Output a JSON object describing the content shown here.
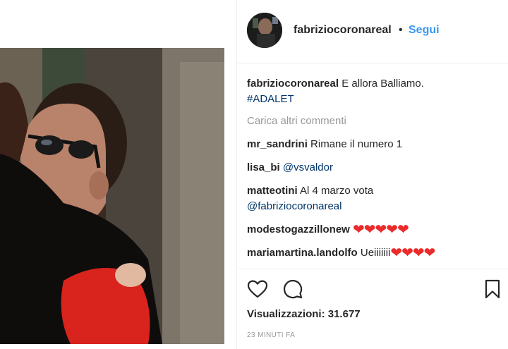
{
  "post": {
    "photo_alt": "",
    "header": {
      "username": "fabriziocoronareal",
      "separator": "•",
      "follow_label": "Segui"
    },
    "caption": {
      "username": "fabriziocoronareal",
      "text": "E allora Balliamo.",
      "hashtag": "#ADALET"
    },
    "load_more_label": "Carica altri commenti",
    "comments": [
      {
        "username": "mr_sandrini",
        "text": "Rimane il numero 1",
        "link": "",
        "hearts": ""
      },
      {
        "username": "lisa_bi",
        "text": "",
        "link": "@vsvaldor",
        "hearts": ""
      },
      {
        "username": "matteotini",
        "text": "Al 4 marzo vota",
        "link": "@fabriziocoronareal",
        "hearts": ""
      },
      {
        "username": "modestogazzillonew",
        "text": "",
        "link": "",
        "hearts": "❤❤❤❤❤"
      },
      {
        "username": "mariamartina.landolfo",
        "text": "Ueiiiiiii",
        "link": "",
        "hearts": "❤❤❤❤"
      }
    ],
    "views": "Visualizzazioni: 31.677",
    "timestamp": "23 MINUTI FA"
  },
  "icons": {
    "like": "heart-outline-icon",
    "comment": "speech-bubble-icon",
    "save": "bookmark-icon"
  },
  "colors": {
    "follow": "#3897f0",
    "link": "#003569",
    "hearts": "#ed2a2a",
    "muted": "#999999"
  }
}
